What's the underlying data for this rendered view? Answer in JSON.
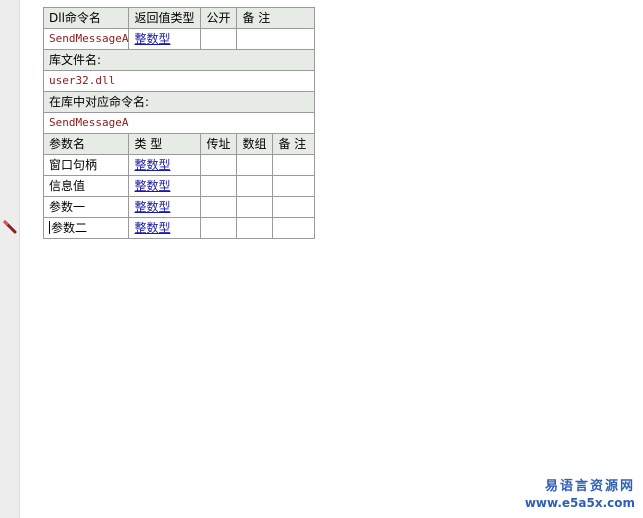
{
  "dll_header": {
    "col_name": "Dll命令名",
    "col_return_type": "返回值类型",
    "col_public": "公开",
    "col_remark": "备 注"
  },
  "dll": {
    "name": "SendMessageA",
    "return_type": "整数型",
    "public": "",
    "remark": ""
  },
  "library": {
    "label": "库文件名:",
    "value": "user32.dll"
  },
  "alias": {
    "label": "在库中对应命令名:",
    "value": "SendMessageA"
  },
  "params_header": {
    "col_name": "参数名",
    "col_type": "类 型",
    "col_byref": "传址",
    "col_array": "数组",
    "col_remark": "备 注"
  },
  "params": [
    {
      "name": "窗口句柄",
      "type": "整数型",
      "byref": "",
      "array": "",
      "remark": ""
    },
    {
      "name": "信息值",
      "type": "整数型",
      "byref": "",
      "array": "",
      "remark": ""
    },
    {
      "name": "参数一",
      "type": "整数型",
      "byref": "",
      "array": "",
      "remark": ""
    },
    {
      "name": "参数二",
      "type": "整数型",
      "byref": "",
      "array": "",
      "remark": ""
    }
  ],
  "watermark": {
    "title": "易语言资源网",
    "url": "www.e5a5x.com"
  },
  "colors": {
    "header_bg": "#e7ebe5",
    "type_link": "#1a1aa6",
    "string_red": "#8b1a1a",
    "watermark": "#2f5fb3"
  }
}
